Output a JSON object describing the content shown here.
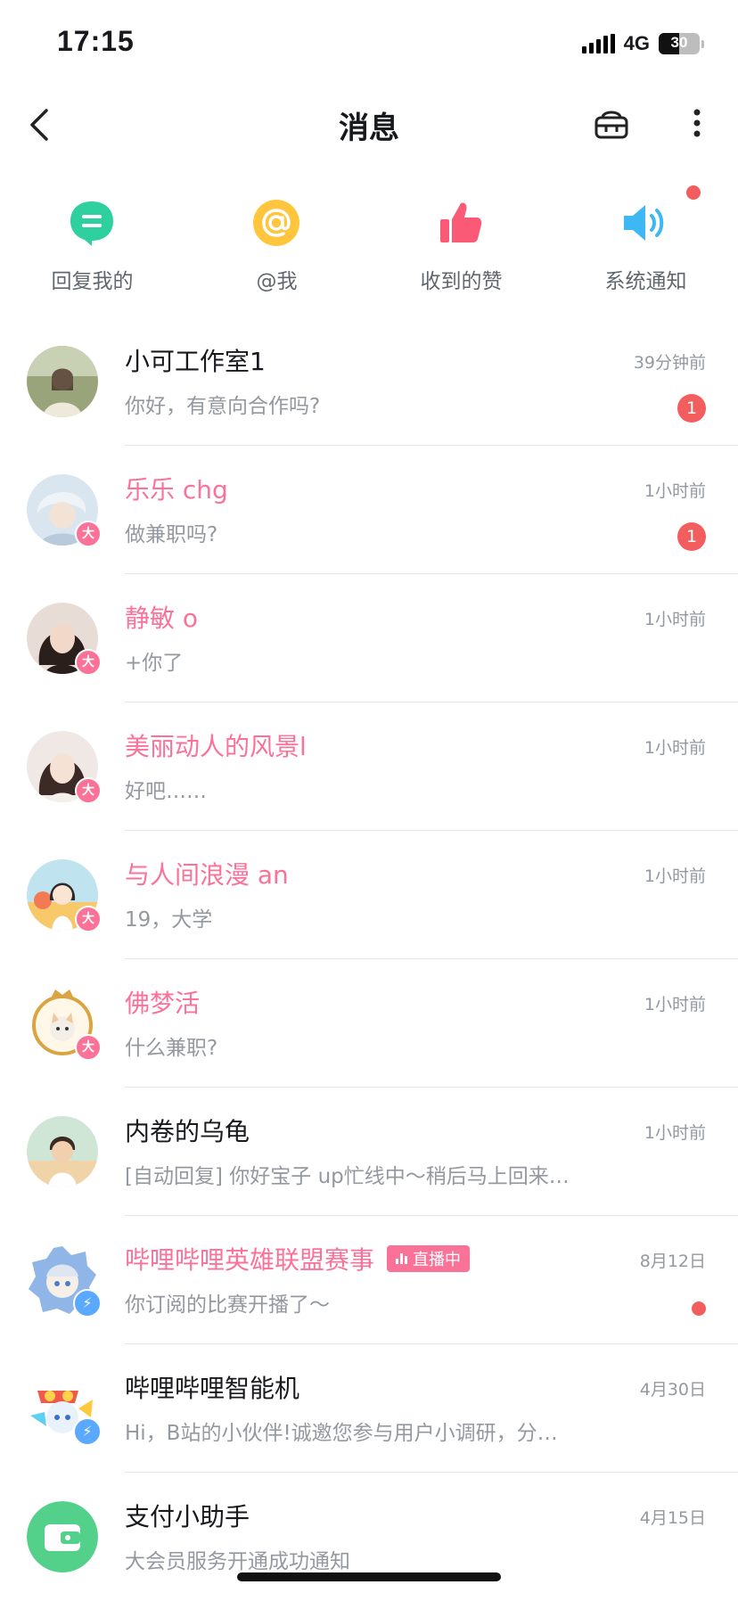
{
  "status_bar": {
    "time": "17:15",
    "network": "4G",
    "battery": "30"
  },
  "header": {
    "title": "消息"
  },
  "quick_entries": [
    {
      "label": "回复我的",
      "icon": "reply-bubble-icon",
      "color": "#2fd0a0"
    },
    {
      "label": "@我",
      "icon": "at-icon",
      "color": "#ffc53d"
    },
    {
      "label": "收到的赞",
      "icon": "thumbs-up-icon",
      "color": "#fb5a77"
    },
    {
      "label": "系统通知",
      "icon": "speaker-icon",
      "color": "#3db8f5",
      "has_new": true
    }
  ],
  "conversations": [
    {
      "name": "小可工作室1",
      "time": "39分钟前",
      "preview": "你好，有意向合作吗?",
      "unread": "1",
      "highlight": false
    },
    {
      "name": "乐乐 chg",
      "time": "1小时前",
      "preview": "做兼职吗?",
      "unread": "1",
      "highlight": true,
      "badge": "大"
    },
    {
      "name": "静敏 o",
      "time": "1小时前",
      "preview": "+你了",
      "highlight": true,
      "badge": "大"
    },
    {
      "name": "美丽动人的风景l",
      "time": "1小时前",
      "preview": "好吧……",
      "highlight": true,
      "badge": "大"
    },
    {
      "name": "与人间浪漫 an",
      "time": "1小时前",
      "preview": "19，大学",
      "highlight": true,
      "badge": "大"
    },
    {
      "name": "佛梦活",
      "time": "1小时前",
      "preview": "什么兼职?",
      "highlight": true,
      "badge": "大"
    },
    {
      "name": "内卷的乌龟",
      "time": "1小时前",
      "preview": "[自动回复] 你好宝子 up忙线中～稍后马上回来…",
      "highlight": false
    },
    {
      "name": "哔哩哔哩英雄联盟赛事",
      "time": "8月12日",
      "preview": "你订阅的比赛开播了～",
      "highlight": true,
      "live_label": "直播中",
      "dot": true
    },
    {
      "name": "哔哩哔哩智能机",
      "time": "4月30日",
      "preview": "Hi，B站的小伙伴!诚邀您参与用户小调研，分…",
      "highlight": false
    },
    {
      "name": "支付小助手",
      "time": "4月15日",
      "preview": "大会员服务开通成功通知",
      "highlight": false
    }
  ],
  "colors": {
    "pink": "#fb7299",
    "red": "#f25d5d",
    "grey_text": "#9499a0"
  }
}
